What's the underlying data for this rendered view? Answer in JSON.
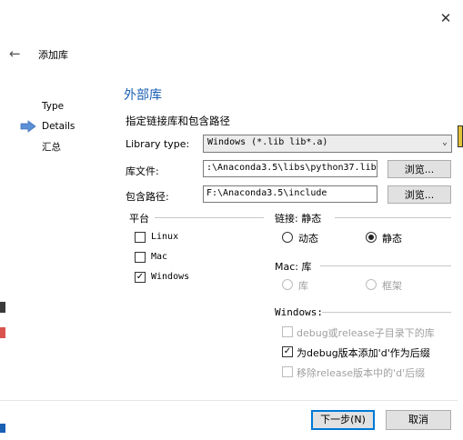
{
  "window": {
    "close_glyph": "✕",
    "back_glyph": "←",
    "title": "添加库"
  },
  "steps": [
    {
      "label": "Type",
      "active": false
    },
    {
      "label": "Details",
      "active": true
    },
    {
      "label": "汇总",
      "active": false
    }
  ],
  "details": {
    "section_title": "外部库",
    "subtitle": "指定链接库和包含路径",
    "library_type": {
      "label": "Library type:",
      "value": "Windows (*.lib lib*.a)",
      "chevron_glyph": "⌄"
    },
    "library_file": {
      "label": "库文件:",
      "value": ":\\Anaconda3.5\\libs\\python37.lib",
      "browse_label": "浏览..."
    },
    "include_path": {
      "label": "包含路径:",
      "value": "F:\\Anaconda3.5\\include",
      "browse_label": "浏览..."
    }
  },
  "platform": {
    "title": "平台",
    "options": [
      {
        "label": "Linux",
        "checked": false
      },
      {
        "label": "Mac",
        "checked": false
      },
      {
        "label": "Windows",
        "checked": true
      }
    ]
  },
  "linking": {
    "title": "链接: 静态",
    "dynamic_label": "动态",
    "static_label": "静态",
    "selected": "静态"
  },
  "mac": {
    "title": "Mac: 库",
    "library_label": "库",
    "framework_label": "框架"
  },
  "windows_opts": {
    "title": "Windows:",
    "options": [
      {
        "label": "debug或release子目录下的库",
        "checked": false,
        "enabled": false
      },
      {
        "label": "为debug版本添加'd'作为后缀",
        "checked": true,
        "enabled": true
      },
      {
        "label": "移除release版本中的'd'后缀",
        "checked": false,
        "enabled": false
      }
    ]
  },
  "footer": {
    "next_label": "下一步(N)",
    "cancel_label": "取消"
  },
  "colors": {
    "accent": "#1a5fb4",
    "arrow": "#5b8fd6",
    "primary_border": "#0078d7"
  }
}
